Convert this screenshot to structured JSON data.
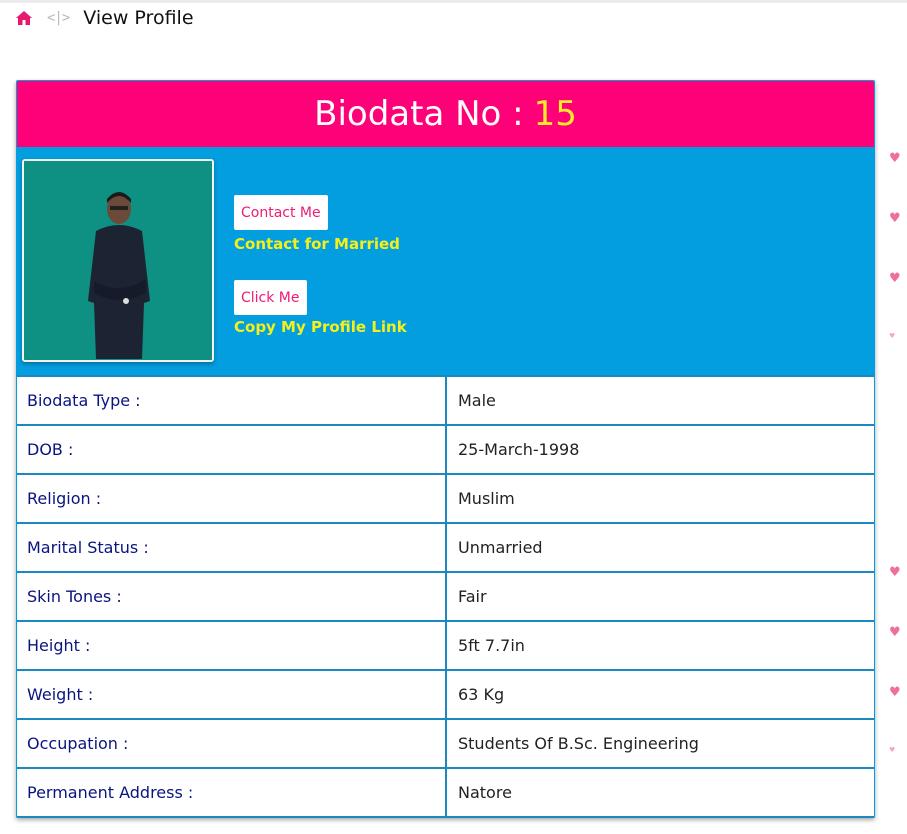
{
  "breadcrumb": {
    "separator": "<|>",
    "current": "View Profile"
  },
  "header": {
    "label": "Biodata No :",
    "number": "15"
  },
  "actions": {
    "contact_button": "Contact Me",
    "contact_caption": "Contact for Married",
    "click_button": "Click Me",
    "click_caption": "Copy My Profile Link"
  },
  "details": [
    {
      "label": "Biodata Type :",
      "value": "Male"
    },
    {
      "label": "DOB :",
      "value": "25-March-1998"
    },
    {
      "label": "Religion :",
      "value": "Muslim"
    },
    {
      "label": "Marital Status :",
      "value": "Unmarried"
    },
    {
      "label": "Skin Tones :",
      "value": "Fair"
    },
    {
      "label": "Height :",
      "value": "5ft 7.7in"
    },
    {
      "label": "Weight :",
      "value": "63 Kg"
    },
    {
      "label": "Occupation :",
      "value": "Students Of B.Sc. Engineering"
    },
    {
      "label": "Permanent Address :",
      "value": "Natore"
    }
  ],
  "colors": {
    "header_bg": "#fe0078",
    "header_number": "#ffeb2a",
    "panel_bg": "#039ee0",
    "caption": "#f5f01a",
    "label_text": "#0a1480",
    "border": "#1b88bf"
  }
}
